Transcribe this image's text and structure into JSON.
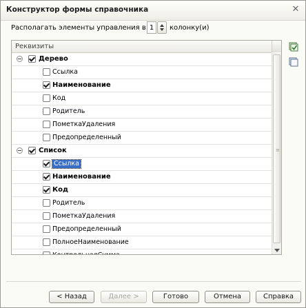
{
  "window": {
    "title": "Конструктор формы справочника"
  },
  "columns": {
    "label_before": "Располагать элементы управления в",
    "value": "1",
    "label_after": "колонку(и)"
  },
  "table": {
    "header": "Реквизиты",
    "groups": [
      {
        "label": "Дерево",
        "checked": true,
        "items": [
          {
            "label": "Ссылка",
            "checked": false,
            "bold": false,
            "selected": false
          },
          {
            "label": "Наименование",
            "checked": true,
            "bold": true,
            "selected": false
          },
          {
            "label": "Код",
            "checked": false,
            "bold": false,
            "selected": false
          },
          {
            "label": "Родитель",
            "checked": false,
            "bold": false,
            "selected": false
          },
          {
            "label": "ПометкаУдаления",
            "checked": false,
            "bold": false,
            "selected": false
          },
          {
            "label": "Предопределенный",
            "checked": false,
            "bold": false,
            "selected": false
          }
        ]
      },
      {
        "label": "Список",
        "checked": true,
        "items": [
          {
            "label": "Ссылка",
            "checked": true,
            "bold": false,
            "selected": true
          },
          {
            "label": "Наименование",
            "checked": true,
            "bold": true,
            "selected": false
          },
          {
            "label": "Код",
            "checked": true,
            "bold": true,
            "selected": false
          },
          {
            "label": "Родитель",
            "checked": false,
            "bold": false,
            "selected": false
          },
          {
            "label": "ПометкаУдаления",
            "checked": false,
            "bold": false,
            "selected": false
          },
          {
            "label": "Предопределенный",
            "checked": false,
            "bold": false,
            "selected": false
          },
          {
            "label": "ПолноеНаименование",
            "checked": false,
            "bold": false,
            "selected": false
          },
          {
            "label": "КонтрольнаяСумма",
            "checked": false,
            "bold": false,
            "selected": false
          }
        ]
      }
    ]
  },
  "side_icons": [
    "check-all-icon",
    "uncheck-all-icon"
  ],
  "buttons": {
    "back": "< Назад",
    "next": "Далее >",
    "done": "Готово",
    "cancel": "Отмена",
    "help": "Справка"
  },
  "colors": {
    "selection": "#3a6ec6",
    "check_icon": "#3c8a3c"
  }
}
